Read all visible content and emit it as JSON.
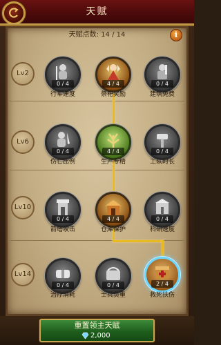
{
  "header": {
    "title": "天赋"
  },
  "talent_points": {
    "label": "天赋点数: 14 / 14"
  },
  "levels": [
    "Lv2",
    "Lv6",
    "Lv10",
    "Lv14"
  ],
  "talents": [
    {
      "name": "行军速度",
      "count": "0 / 4",
      "state": "locked",
      "icon": "soldier-icon"
    },
    {
      "name": "祭祀奖励",
      "count": "4 / 4",
      "state": "active",
      "icon": "priestess-icon"
    },
    {
      "name": "建筑免费",
      "count": "0 / 4",
      "state": "locked",
      "icon": "builder-icon"
    },
    {
      "name": "伤亡比例",
      "count": "0 / 4",
      "state": "locked",
      "icon": "warrior-icon"
    },
    {
      "name": "生产专精",
      "count": "4 / 4",
      "state": "green",
      "icon": "crops-icon"
    },
    {
      "name": "工队时长",
      "count": "0 / 4",
      "state": "locked",
      "icon": "hammer-icon"
    },
    {
      "name": "箭塔攻击",
      "count": "0 / 4",
      "state": "locked",
      "icon": "tower-icon"
    },
    {
      "name": "仓库保护",
      "count": "4 / 4",
      "state": "active",
      "icon": "warehouse-icon"
    },
    {
      "name": "科研速度",
      "count": "0 / 4",
      "state": "locked",
      "icon": "research-icon"
    },
    {
      "name": "治疗消耗",
      "count": "0 / 4",
      "state": "locked",
      "icon": "bandage-icon"
    },
    {
      "name": "士兵负重",
      "count": "0 / 4",
      "state": "locked",
      "icon": "cargo-icon"
    },
    {
      "name": "救死扶伤",
      "count": "2 / 4",
      "state": "highlight",
      "icon": "medic-chest-icon"
    }
  ],
  "reset_button": {
    "label": "重置领主天赋",
    "cost": "2,000",
    "cost_icon": "diamond-icon"
  },
  "colors": {
    "link": "#e8b923",
    "header": "#4a0a0a",
    "button": "#1f5e1d"
  }
}
